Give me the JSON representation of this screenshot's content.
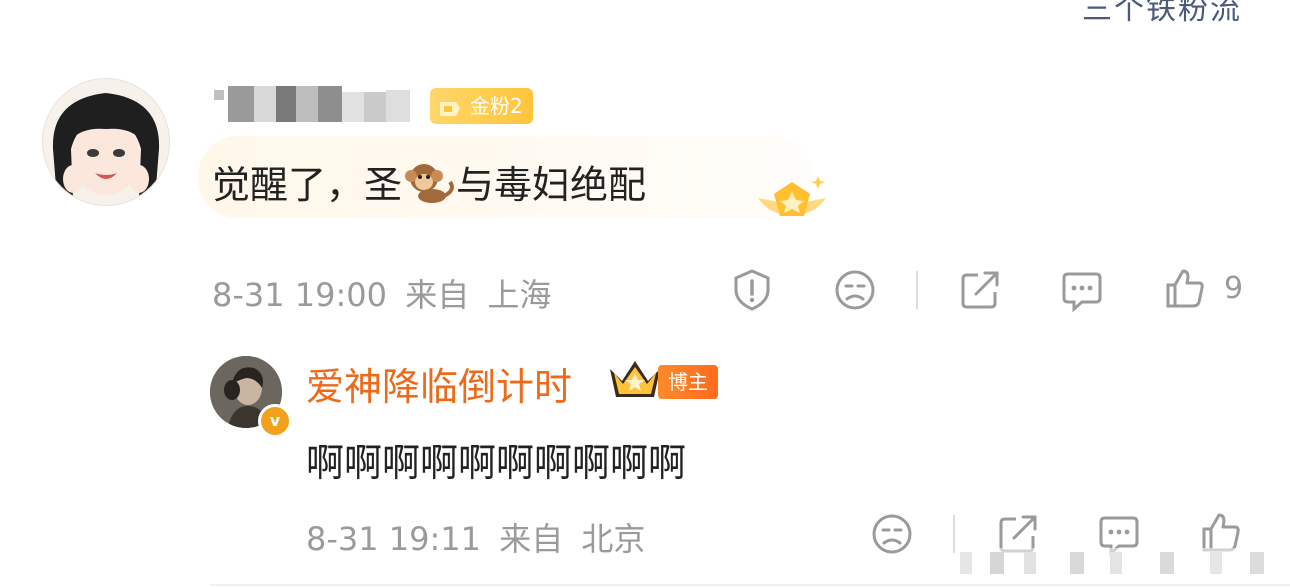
{
  "top_label": "三个铁粉流",
  "comment": {
    "badge_label": "金粉2",
    "text_before": "觉醒了，圣",
    "emoji": "monkey-emoji",
    "text_after": "与毒妇绝配",
    "timestamp": "8-31 19:00",
    "location_prefix": "来自",
    "location": "上海",
    "like_count": "9"
  },
  "reply": {
    "author": "爱神降临倒计时",
    "author_badge": "博主",
    "text": "啊啊啊啊啊啊啊啊啊啊",
    "timestamp": "8-31 19:11",
    "location_prefix": "来自",
    "location": "北京"
  },
  "icons": {
    "report": "warning-shield-icon",
    "dislike": "sad-face-icon",
    "share": "share-icon",
    "comment": "comment-icon",
    "like": "thumbs-up-icon"
  },
  "colors": {
    "accent_orange": "#ec6a1a",
    "meta_gray": "#9a9a9a",
    "gold": "#ffc43b"
  }
}
